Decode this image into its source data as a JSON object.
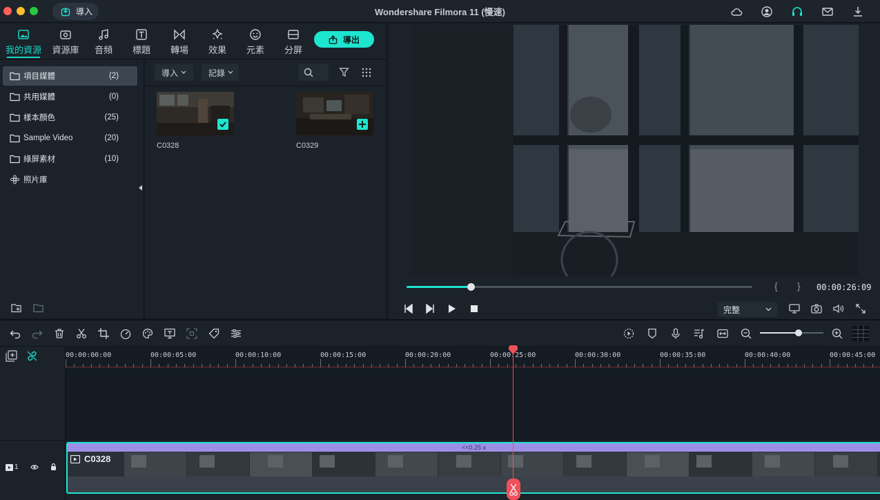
{
  "app": {
    "title": "Wondershare Filmora 11 (慢速)",
    "import_button": "導入"
  },
  "media_tabs": [
    {
      "label": "我的資源",
      "icon": "image-icon",
      "active": true
    },
    {
      "label": "資源庫",
      "icon": "stock-icon"
    },
    {
      "label": "音頻",
      "icon": "music-note-icon"
    },
    {
      "label": "標題",
      "icon": "title-t-icon"
    },
    {
      "label": "轉場",
      "icon": "transition-icon"
    },
    {
      "label": "效果",
      "icon": "sparkle-icon"
    },
    {
      "label": "元素",
      "icon": "smiley-icon"
    },
    {
      "label": "分屏",
      "icon": "split-screen-icon"
    }
  ],
  "export_button": "導出",
  "sidebar": {
    "items": [
      {
        "label": "項目媒體",
        "count": "(2)",
        "active": true
      },
      {
        "label": "共用媒體",
        "count": "(0)"
      },
      {
        "label": "樣本顏色",
        "count": "(25)"
      },
      {
        "label": "Sample Video",
        "count": "(20)"
      },
      {
        "label": "綠屏素材",
        "count": "(10)"
      },
      {
        "label": "照片庫",
        "count": ""
      }
    ]
  },
  "media_toolbar": {
    "import_dropdown": "導入",
    "record_dropdown": "記錄"
  },
  "media_items": [
    {
      "name": "C0328",
      "badge": "check"
    },
    {
      "name": "C0329",
      "badge": "plus"
    }
  ],
  "preview": {
    "timecode": "00:00:26:09",
    "quality": "完整",
    "progress": 0.19
  },
  "timeline": {
    "ruler_labels": [
      "00:00:00:00",
      "00:00:05:00",
      "00:00:10:00",
      "00:00:15:00",
      "00:00:20:00",
      "00:00:25:00",
      "00:00:30:00",
      "00:00:35:00",
      "00:00:40:00",
      "00:00:45:00"
    ],
    "clip_name": "C0328",
    "speed_label": "<<0.25 x",
    "track_number": "1"
  },
  "colors": {
    "accent": "#1de5cf",
    "playhead": "#f0505a",
    "speed_bar": "#9d8fe6",
    "background": "#151b22"
  }
}
